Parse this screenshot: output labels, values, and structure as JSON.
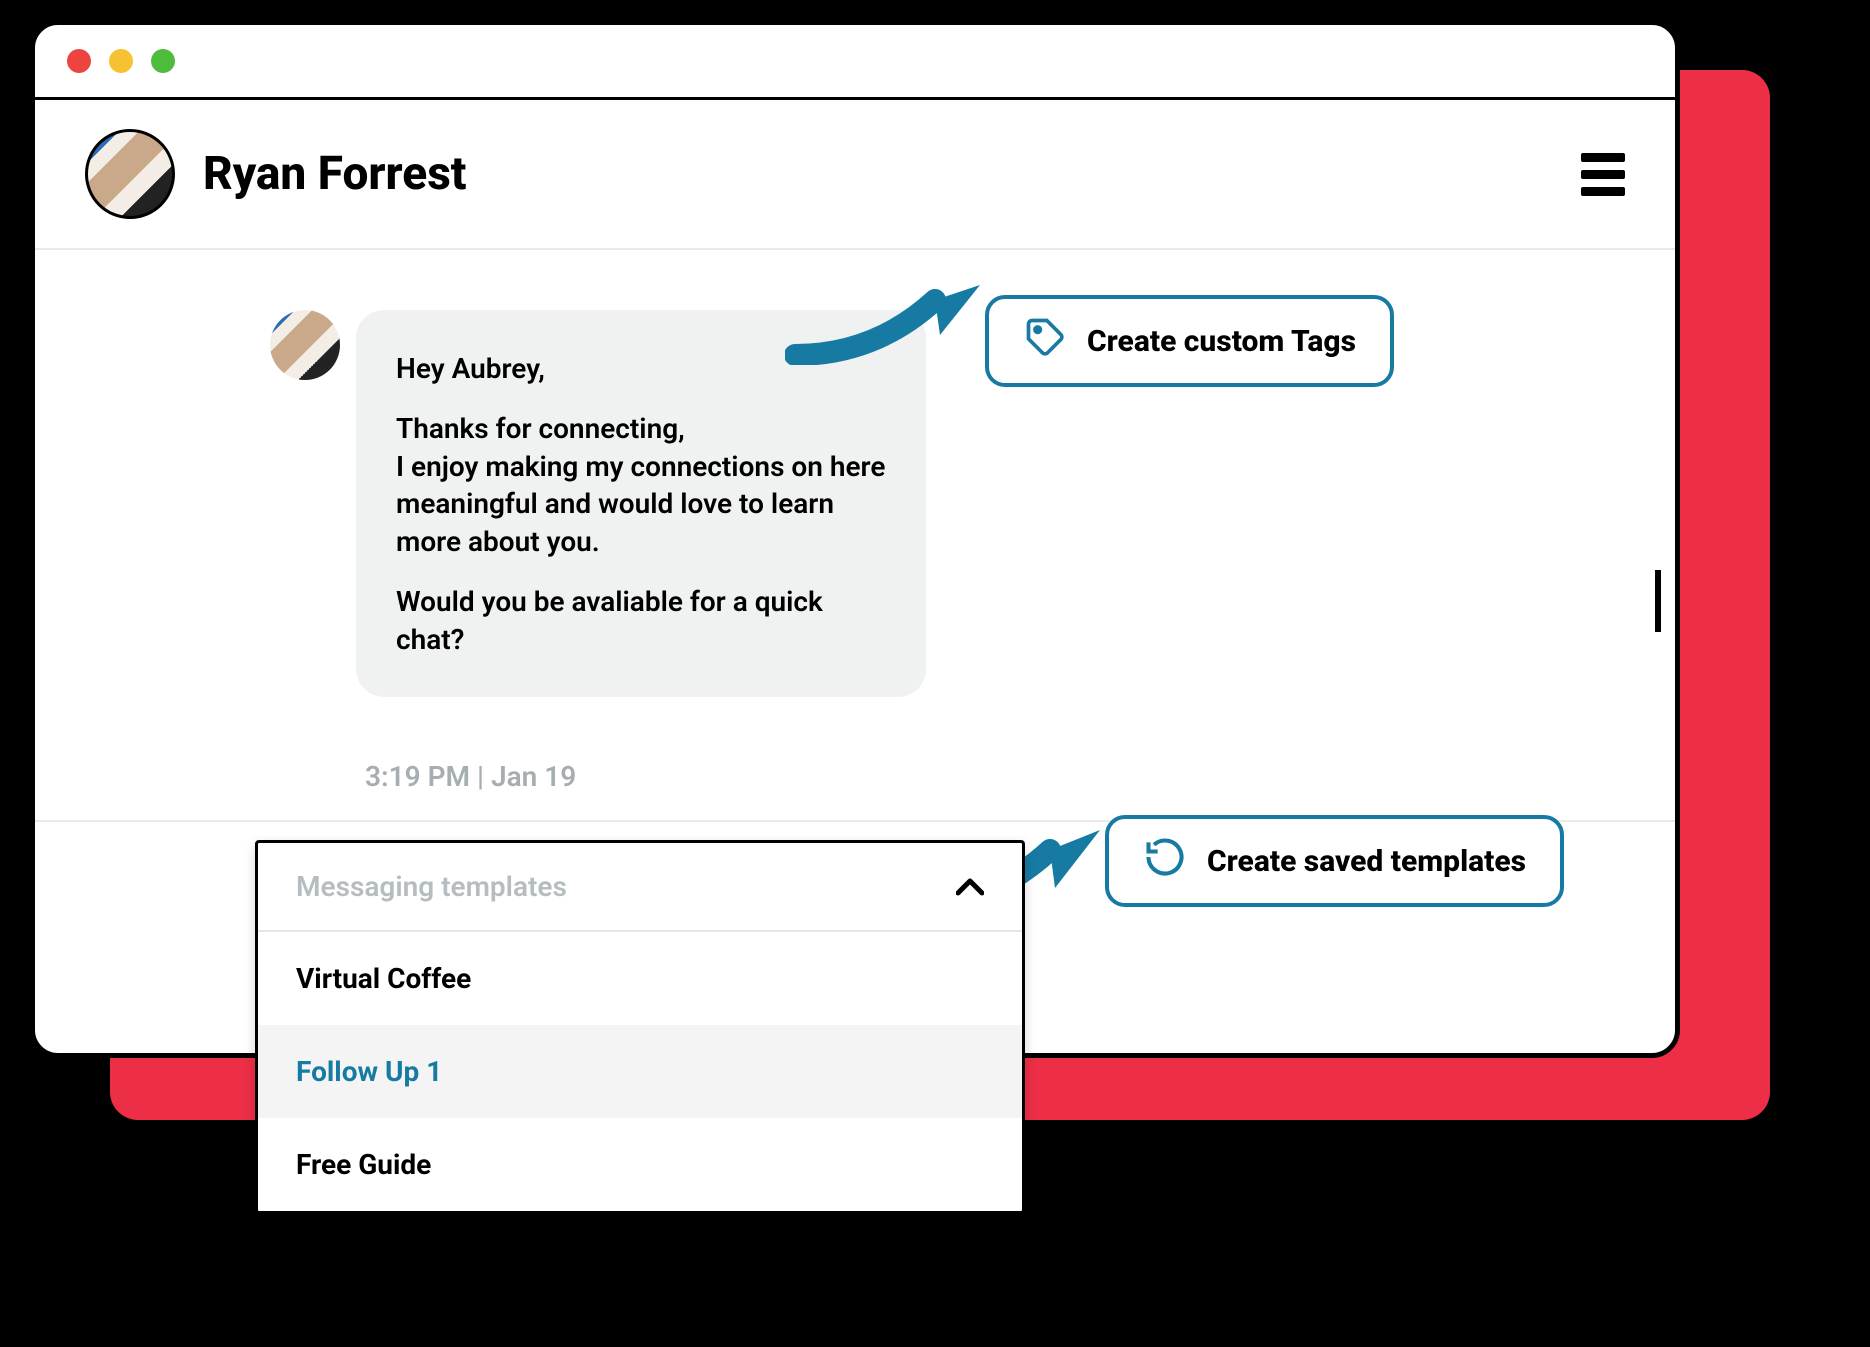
{
  "header": {
    "user_name": "Ryan Forrest"
  },
  "message": {
    "greeting": "Hey Aubrey,",
    "body": "Thanks for connecting,\nI enjoy making my connections on here meaningful and would love to learn more about you.",
    "cta": "Would you be avaliable for a quick chat?",
    "timestamp": "3:19 PM | Jan 19"
  },
  "callouts": {
    "tags_label": "Create custom Tags",
    "templates_label": "Create saved templates"
  },
  "dropdown": {
    "title": "Messaging templates",
    "items": [
      {
        "label": "Virtual Coffee",
        "active": false
      },
      {
        "label": "Follow Up 1",
        "active": true
      },
      {
        "label": "Free Guide",
        "active": false
      }
    ]
  },
  "colors": {
    "accent": "#177aa3",
    "brand_red": "#ec2f47"
  }
}
